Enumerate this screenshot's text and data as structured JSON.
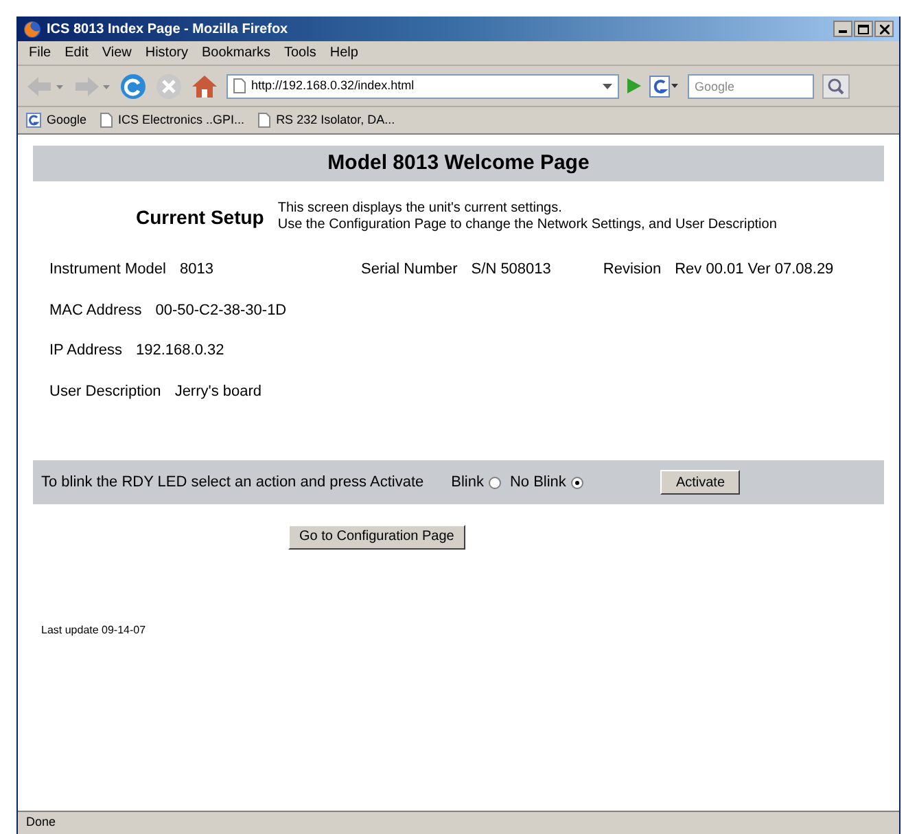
{
  "window": {
    "title": "ICS 8013 Index Page - Mozilla Firefox"
  },
  "menu": [
    "File",
    "Edit",
    "View",
    "History",
    "Bookmarks",
    "Tools",
    "Help"
  ],
  "address_bar": {
    "value": "http://192.168.0.32/index.html"
  },
  "search": {
    "placeholder": "Google"
  },
  "bookmarks": [
    {
      "label": "Google",
      "kind": "google"
    },
    {
      "label": "ICS Electronics ..GPI...",
      "kind": "page"
    },
    {
      "label": "RS 232 Isolator, DA...",
      "kind": "page"
    }
  ],
  "page": {
    "heading": "Model 8013 Welcome Page",
    "setup_title": "Current Setup",
    "setup_text": [
      "This screen displays the unit's current settings.",
      "Use the Configuration Page to change the Network Settings, and User Description"
    ],
    "info_rows": [
      [
        {
          "label": "Instrument Model",
          "value": "8013"
        },
        {
          "label": "Serial Number",
          "value": "S/N 508013"
        },
        {
          "label": "Revision",
          "value": "Rev 00.01 Ver 07.08.29"
        }
      ],
      [
        {
          "label": "MAC Address",
          "value": "00-50-C2-38-30-1D"
        }
      ],
      [
        {
          "label": "IP Address",
          "value": "192.168.0.32"
        }
      ],
      [
        {
          "label": "User Description",
          "value": "Jerry's board"
        }
      ]
    ],
    "blink_prompt": "To blink the RDY LED select an action and press Activate",
    "blink_options": [
      {
        "label": "Blink",
        "selected": false
      },
      {
        "label": "No Blink",
        "selected": true
      }
    ],
    "activate_button": "Activate",
    "config_button": "Go to Configuration Page",
    "last_update": "Last update 09-14-07"
  },
  "status_bar": "Done"
}
